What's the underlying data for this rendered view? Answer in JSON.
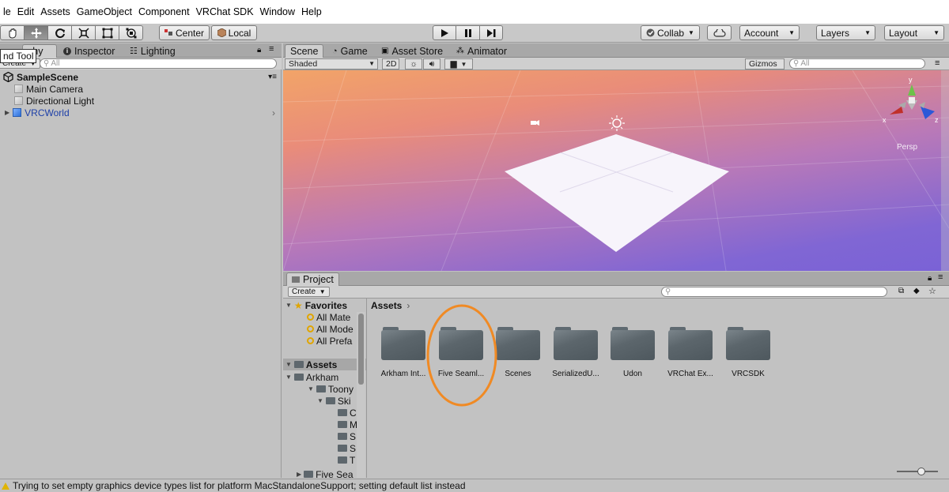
{
  "menu": [
    "le",
    "Edit",
    "Assets",
    "GameObject",
    "Component",
    "VRChat SDK",
    "Window",
    "Help"
  ],
  "toolbar": {
    "tools": [
      "hand-tool",
      "move-tool",
      "rotate-tool",
      "scale-tool",
      "rect-tool",
      "transform-tool"
    ],
    "pivot_center": "Center",
    "pivot_local": "Local",
    "collab": "Collab",
    "account": "Account",
    "layers": "Layers",
    "layout": "Layout"
  },
  "tooltip": "nd Tool",
  "hierarchy": {
    "tabs": [
      "chy",
      "Inspector",
      "Lighting"
    ],
    "create": "Create",
    "search_placeholder": "All",
    "scene": "SampleScene",
    "items": [
      "Main Camera",
      "Directional Light",
      "VRCWorld"
    ]
  },
  "scene": {
    "tabs": [
      "Scene",
      "Game",
      "Asset Store",
      "Animator"
    ],
    "shading": "Shaded",
    "mode2d": "2D",
    "gizmos": "Gizmos",
    "search_placeholder": "All",
    "gizmo_axes": [
      "y",
      "x",
      "z"
    ],
    "persp_label": "Persp"
  },
  "project": {
    "tab": "Project",
    "create": "Create",
    "favorites": "Favorites",
    "favorite_items": [
      "All Mate",
      "All Mode",
      "All Prefa"
    ],
    "assets": "Assets",
    "tree": [
      "Arkham",
      "Toony",
      "Ski",
      "C",
      "M",
      "S",
      "S",
      "T",
      "Five Sea"
    ],
    "breadcrumb": "Assets",
    "folders": [
      "Arkham Int...",
      "Five Seaml...",
      "Scenes",
      "SerializedU...",
      "Udon",
      "VRChat Ex...",
      "VRCSDK"
    ]
  },
  "annotation_color": "#f08a24",
  "status": "Trying to set empty graphics device types list for platform MacStandaloneSupport; setting default list instead"
}
